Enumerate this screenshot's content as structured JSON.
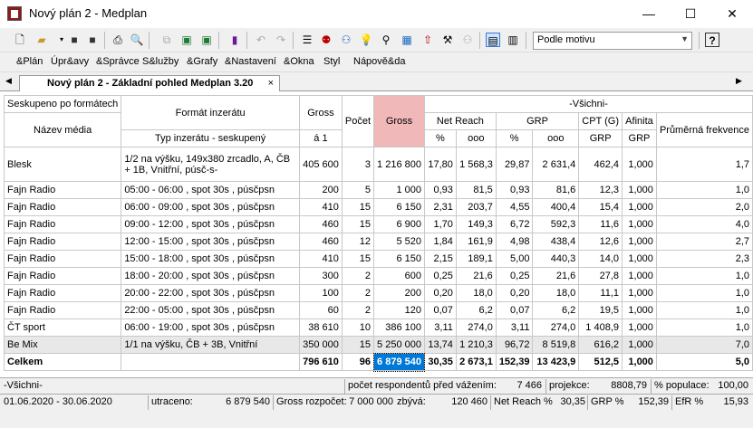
{
  "window": {
    "title": "Nový plán 2 - Medplan",
    "minimize": "—",
    "maximize": "☐",
    "close": "✕"
  },
  "toolbar": {
    "combo_value": "Podle motivu",
    "help": "?"
  },
  "menu": [
    "&Plán",
    "Úpr&avy",
    "&Správce",
    "S&lužby",
    "&Grafy",
    "&Nastavení",
    "&Okna",
    "Styl",
    "Nápově&da"
  ],
  "tab": {
    "label": "Nový plán 2 - Základní pohled Medplan 3.20",
    "close": "×"
  },
  "header": {
    "group": "Seskupeno po formátech",
    "media": "Název média",
    "format": "Formát inzerátu",
    "type": "Typ inzerátu - seskupený",
    "gross": "Gross",
    "gross_unit": "á 1",
    "count": "Počet",
    "gross2": "Gross",
    "all": "-Všichni-",
    "netreach": "Net Reach",
    "grp": "GRP",
    "cpt": "CPT (G)",
    "afinita": "Afinita",
    "freq": "Průměrná frekvence",
    "pct": "%",
    "ooo": "ooo",
    "grp_sub": "GRP"
  },
  "rows": [
    {
      "media": "Blesk",
      "format": "1/2 na výšku, 149x380 zrcadlo, A, ČB + 1B, Vnitřní, púsč-s-",
      "gross": "405 600",
      "count": "3",
      "gross2": "1 216 800",
      "nr_pct": "17,80",
      "nr_ooo": "1 568,3",
      "grp_pct": "29,87",
      "grp_ooo": "2 631,4",
      "cpt": "462,4",
      "afinita": "1,000",
      "freq": "1,7"
    },
    {
      "media": "Fajn Radio",
      "format": "05:00 - 06:00 , spot 30s , púsčpsn",
      "gross": "200",
      "count": "5",
      "gross2": "1 000",
      "nr_pct": "0,93",
      "nr_ooo": "81,5",
      "grp_pct": "0,93",
      "grp_ooo": "81,6",
      "cpt": "12,3",
      "afinita": "1,000",
      "freq": "1,0"
    },
    {
      "media": "Fajn Radio",
      "format": "06:00 - 09:00 , spot 30s , púsčpsn",
      "gross": "410",
      "count": "15",
      "gross2": "6 150",
      "nr_pct": "2,31",
      "nr_ooo": "203,7",
      "grp_pct": "4,55",
      "grp_ooo": "400,4",
      "cpt": "15,4",
      "afinita": "1,000",
      "freq": "2,0"
    },
    {
      "media": "Fajn Radio",
      "format": "09:00 - 12:00 , spot 30s , púsčpsn",
      "gross": "460",
      "count": "15",
      "gross2": "6 900",
      "nr_pct": "1,70",
      "nr_ooo": "149,3",
      "grp_pct": "6,72",
      "grp_ooo": "592,3",
      "cpt": "11,6",
      "afinita": "1,000",
      "freq": "4,0"
    },
    {
      "media": "Fajn Radio",
      "format": "12:00 - 15:00 , spot 30s , púsčpsn",
      "gross": "460",
      "count": "12",
      "gross2": "5 520",
      "nr_pct": "1,84",
      "nr_ooo": "161,9",
      "grp_pct": "4,98",
      "grp_ooo": "438,4",
      "cpt": "12,6",
      "afinita": "1,000",
      "freq": "2,7"
    },
    {
      "media": "Fajn Radio",
      "format": "15:00 - 18:00 , spot 30s , púsčpsn",
      "gross": "410",
      "count": "15",
      "gross2": "6 150",
      "nr_pct": "2,15",
      "nr_ooo": "189,1",
      "grp_pct": "5,00",
      "grp_ooo": "440,3",
      "cpt": "14,0",
      "afinita": "1,000",
      "freq": "2,3"
    },
    {
      "media": "Fajn Radio",
      "format": "18:00 - 20:00 , spot 30s , púsčpsn",
      "gross": "300",
      "count": "2",
      "gross2": "600",
      "nr_pct": "0,25",
      "nr_ooo": "21,6",
      "grp_pct": "0,25",
      "grp_ooo": "21,6",
      "cpt": "27,8",
      "afinita": "1,000",
      "freq": "1,0"
    },
    {
      "media": "Fajn Radio",
      "format": "20:00 - 22:00 , spot 30s , púsčpsn",
      "gross": "100",
      "count": "2",
      "gross2": "200",
      "nr_pct": "0,20",
      "nr_ooo": "18,0",
      "grp_pct": "0,20",
      "grp_ooo": "18,0",
      "cpt": "11,1",
      "afinita": "1,000",
      "freq": "1,0"
    },
    {
      "media": "Fajn Radio",
      "format": "22:00 - 05:00 , spot 30s , púsčpsn",
      "gross": "60",
      "count": "2",
      "gross2": "120",
      "nr_pct": "0,07",
      "nr_ooo": "6,2",
      "grp_pct": "0,07",
      "grp_ooo": "6,2",
      "cpt": "19,5",
      "afinita": "1,000",
      "freq": "1,0"
    },
    {
      "media": "ČT sport",
      "format": "06:00 - 19:00 , spot 30s , púsčpsn",
      "gross": "38 610",
      "count": "10",
      "gross2": "386 100",
      "nr_pct": "3,11",
      "nr_ooo": "274,0",
      "grp_pct": "3,11",
      "grp_ooo": "274,0",
      "cpt": "1 408,9",
      "afinita": "1,000",
      "freq": "1,0"
    },
    {
      "media": "Be Mix",
      "format": "1/1 na výšku, ČB + 3B, Vnitřní",
      "gross": "350 000",
      "count": "15",
      "gross2": "5 250 000",
      "nr_pct": "13,74",
      "nr_ooo": "1 210,3",
      "grp_pct": "96,72",
      "grp_ooo": "8 519,8",
      "cpt": "616,2",
      "afinita": "1,000",
      "freq": "7,0"
    }
  ],
  "total": {
    "media": "Celkem",
    "gross": "796 610",
    "count": "96",
    "gross2": "6 879 540",
    "nr_pct": "30,35",
    "nr_ooo": "2 673,1",
    "grp_pct": "152,39",
    "grp_ooo": "13 423,9",
    "cpt": "512,5",
    "afinita": "1,000",
    "freq": "5,0"
  },
  "status1": {
    "target": "-Všichni-",
    "resp_label": "počet respondentů před vážením:",
    "resp_val": "7 466",
    "proj_label": "projekce:",
    "proj_val": "8808,79",
    "pop_label": "% populace:",
    "pop_val": "100,00"
  },
  "status2": {
    "period": "01.06.2020 - 30.06.2020",
    "spent_label": "utraceno:",
    "spent_val": "6 879 540",
    "budget_label": "Gross rozpočet:",
    "budget_val": "7 000 000",
    "remain_label": "zbývá:",
    "remain_val": "120 460",
    "nr_label": "Net Reach %",
    "nr_val": "30,35",
    "grp_label": "GRP %",
    "grp_val": "152,39",
    "efr_label": "EfR %",
    "efr_val": "15,93"
  }
}
